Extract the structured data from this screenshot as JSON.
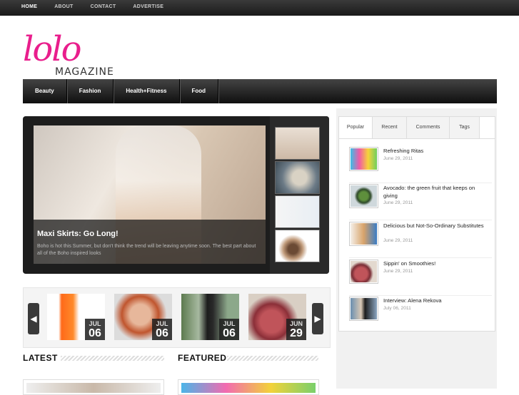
{
  "topnav": [
    "HOME",
    "ABOUT",
    "CONTACT",
    "ADVERTISE"
  ],
  "logo": {
    "script": "lolo",
    "sub": "MAGAZINE"
  },
  "categories": [
    "Beauty",
    "Fashion",
    "Health+Fitness",
    "Food"
  ],
  "slider": {
    "title": "Maxi Skirts: Go Long!",
    "excerpt": "Boho is hot this Summer, but don't think the trend will be leaving anytime soon. The best part about all of the Boho inspired looks"
  },
  "carousel": [
    {
      "month": "JUL",
      "day": "06"
    },
    {
      "month": "JUL",
      "day": "06"
    },
    {
      "month": "JUL",
      "day": "06"
    },
    {
      "month": "JUN",
      "day": "29"
    }
  ],
  "sections": {
    "latest": "LATEST",
    "featured": "FEATURED"
  },
  "sidebar": {
    "tabs": [
      "Popular",
      "Recent",
      "Comments",
      "Tags"
    ],
    "posts": [
      {
        "title": "Refreshing Ritas",
        "date": "June 29, 2011"
      },
      {
        "title": "Avocado: the green fruit that keeps on giving",
        "date": "June 29, 2011"
      },
      {
        "title": "Delicious but Not-So-Ordinary Substitutes",
        "date": "June 29, 2011"
      },
      {
        "title": "Sippin' on Smoothies!",
        "date": "June 29, 2011"
      },
      {
        "title": "Interview: Alena Rekova",
        "date": "July 06, 2011"
      }
    ]
  },
  "colors": {
    "accent": "#e91e8c",
    "nav_dark": "#1a1a1a"
  }
}
